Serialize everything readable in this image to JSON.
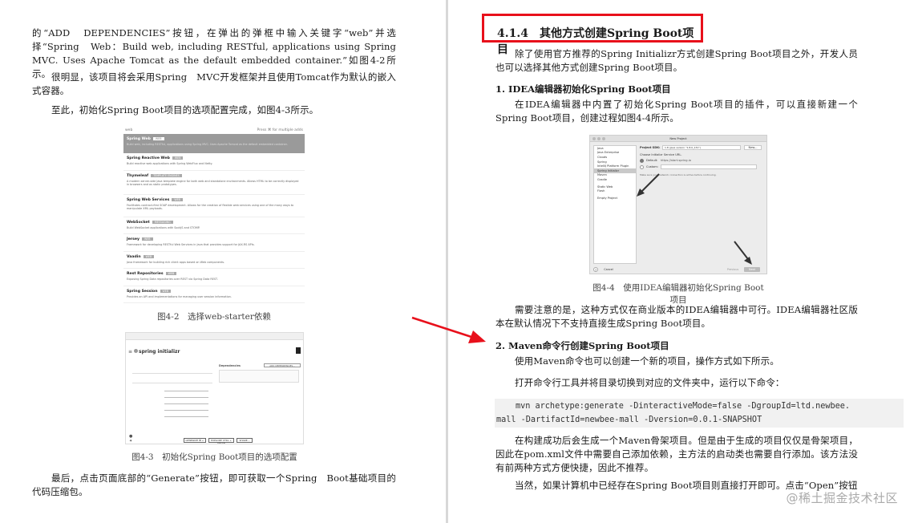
{
  "left_page": {
    "para1": "的“ADD　DEPENDENCIES”按钮，在弹出的弹框中输入关键字“web”并选择“Spring　Web：Build web, including RESTful, applications using Spring MVC. Uses Apache Tomcat as the default embedded container.”如图4-2所示。",
    "para2": "很明显，该项目将会采用Spring　MVC开发框架并且使用Tomcat作为默认的嵌入式容器。",
    "para3": "至此，初始化Spring Boot项目的选项配置完成，如图4-3所示。",
    "fig42_caption": "图4-2　选择web-starter依赖",
    "fig43_caption": "图4-3　初始化Spring Boot项目的选项配置",
    "para4": "最后，点击页面底部的“Generate”按钮，即可获取一个Spring　Boot基础项目的代码压缩包。"
  },
  "fig42": {
    "search_text": "web",
    "hint": "Press ⌘ for multiple adds",
    "items": [
      {
        "name": "Spring Web",
        "tag": "WEB",
        "desc": "Build web, including RESTful, applications using Spring MVC. Uses Apache Tomcat as the default embedded container."
      },
      {
        "name": "Spring Reactive Web",
        "tag": "WEB",
        "desc": "Build reactive web applications with Spring WebFlux and Netty."
      },
      {
        "name": "Thymeleaf",
        "tag": "TEMPLATE ENGINES",
        "desc": "A modern server-side Java template engine for both web and standalone environments. Allows HTML to be correctly displayed in browsers and as static prototypes."
      },
      {
        "name": "Spring Web Services",
        "tag": "WEB",
        "desc": "Facilitates contract-first SOAP development. Allows for the creation of flexible web services using one of the many ways to manipulate XML payloads."
      },
      {
        "name": "WebSocket",
        "tag": "MESSAGING",
        "desc": "Build WebSocket applications with SockJS and STOMP."
      },
      {
        "name": "Jersey",
        "tag": "WEB",
        "desc": "Framework for developing RESTful Web Services in Java that provides support for JAX-RS APIs."
      },
      {
        "name": "Vaadin",
        "tag": "WEB",
        "desc": "Java framework for building rich client apps based on Web components."
      },
      {
        "name": "Rest Repositories",
        "tag": "WEB",
        "desc": "Exposing Spring Data repositories over REST via Spring Data REST."
      },
      {
        "name": "Spring Session",
        "tag": "WEB",
        "desc": "Provides an API and implementations for managing user session information."
      }
    ]
  },
  "fig43": {
    "logo": "spring initializr",
    "dependencies_label": "Dependencies",
    "add_button": "ADD DEPENDENCIES...",
    "generate": "GENERATE ⌘ ↵",
    "explore": "EXPLORE CTRL + SPACE",
    "share": "SHARE..."
  },
  "right_page": {
    "chapter_num": "4.1.4",
    "chapter_title": "其他方式创建Spring Boot项目",
    "intro": "除了使用官方推荐的Spring Initializr方式创建Spring Boot项目之外，开发人员也可以选择其他方式创建Spring Boot项目。",
    "h1": "1. IDEA编辑器初始化Spring Boot项目",
    "h1_text": "在IDEA编辑器中内置了初始化Spring Boot项目的插件，可以直接新建一个Spring Boot项目，创建过程如图4-4所示。",
    "fig44_caption": "图4-4　使用IDEA编辑器初始化Spring Boot项目",
    "note": "需要注意的是，这种方式仅在商业版本的IDEA编辑器中可行。IDEA编辑器社区版本在默认情况下不支持直接生成Spring Boot项目。",
    "h2": "2. Maven命令行创建Spring Boot项目",
    "h2_text1": "使用Maven命令也可以创建一个新的项目，操作方式如下所示。",
    "h2_text2": "打开命令行工具并将目录切换到对应的文件夹中，运行以下命令：",
    "code_line1": "mvn archetype:generate -DinteractiveMode=false -DgroupId=ltd.newbee.",
    "code_line2": "mall -DartifactId=newbee-mall -Dversion=0.0.1-SNAPSHOT",
    "after_code": "在构建成功后会生成一个Maven骨架项目。但是由于生成的项目仅仅是骨架项目，因此在pom.xml文件中需要自己添加依赖，主方法的启动类也需要自行添加。该方法没有前两种方式方便快捷，因此不推荐。",
    "last": "当然，如果计算机中已经存在Spring Boot项目则直接打开即可。点击“Open”按钮跳出文"
  },
  "fig44": {
    "title": "New Project",
    "list": [
      "Java",
      "Java Enterprise",
      "Clouds",
      "Spring",
      "IntelliJ Platform Plugin",
      "Spring Initializr",
      "Maven",
      "Gradle",
      "Static Web",
      "Flash",
      "Empty Project"
    ],
    "sdk_label": "Project SDK:",
    "sdk_value": "1.8 (java version \"1.8.0_131\")",
    "new_btn": "New...",
    "service_label": "Choose Initializr Service URL.",
    "default_label": "Default:",
    "default_url": "https://start.spring.io",
    "custom_label": "Custom:",
    "hint": "Make sure your network connection is active before continuing.",
    "help": "?",
    "cancel": "Cancel",
    "previous": "Previous",
    "next": "Next"
  },
  "watermark": "@稀土掘金技术社区",
  "colors": {
    "highlight_box": "#e8101b",
    "arrow": "#e8101b"
  }
}
